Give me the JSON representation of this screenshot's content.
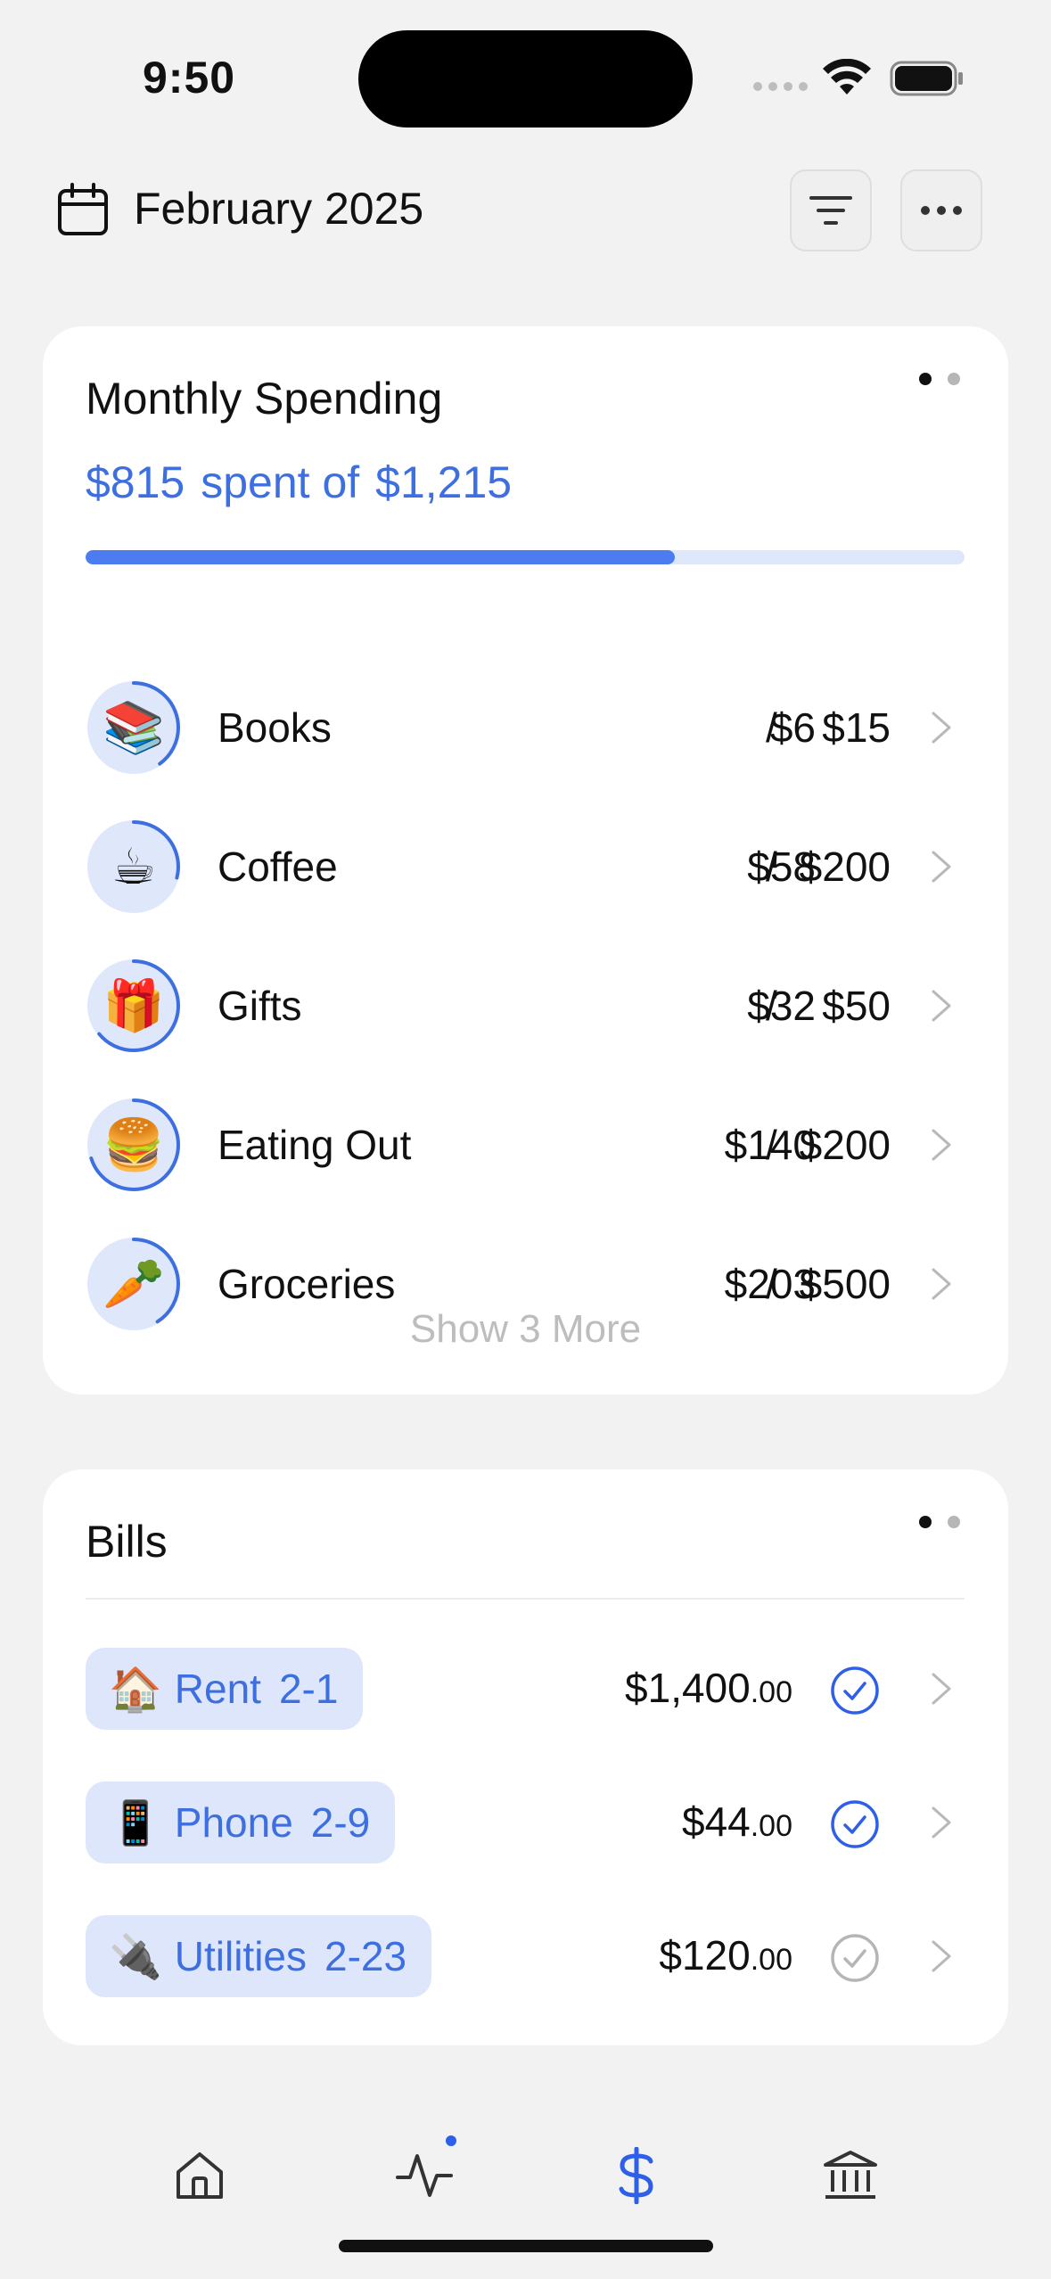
{
  "status_bar": {
    "time": "9:50"
  },
  "header": {
    "title": "February 2025"
  },
  "spending": {
    "title": "Monthly Spending",
    "spent": "$815",
    "spent_of": "spent of",
    "budget": "$1,215",
    "progress_fraction": 0.67,
    "accent_color": "#3d6fe0",
    "categories": [
      {
        "emoji": "📚",
        "name": "Books",
        "spent": "$6",
        "slash": "/",
        "budget": "$15",
        "fraction": 0.4
      },
      {
        "emoji": "☕",
        "name": "Coffee",
        "spent": "$58",
        "slash": "/",
        "budget": "$200",
        "fraction": 0.29
      },
      {
        "emoji": "🎁",
        "name": "Gifts",
        "spent": "$32",
        "slash": "/",
        "budget": "$50",
        "fraction": 0.64
      },
      {
        "emoji": "🍔",
        "name": "Eating Out",
        "spent": "$140",
        "slash": "/",
        "budget": "$200",
        "fraction": 0.7
      },
      {
        "emoji": "🥕",
        "name": "Groceries",
        "spent": "$203",
        "slash": "/",
        "budget": "$500",
        "fraction": 0.41
      }
    ],
    "show_more": "Show 3 More"
  },
  "bills": {
    "title": "Bills",
    "items": [
      {
        "emoji": "🏠",
        "name": "Rent",
        "date": "2-1",
        "amount": "$1,400",
        "cents": ".00",
        "paid": true
      },
      {
        "emoji": "📱",
        "name": "Phone",
        "date": "2-9",
        "amount": "$44",
        "cents": ".00",
        "paid": true
      },
      {
        "emoji": "🔌",
        "name": "Utilities",
        "date": "2-23",
        "amount": "$120",
        "cents": ".00",
        "paid": false
      }
    ]
  },
  "tabbar": {
    "active_tab": "money",
    "icons": [
      "home-icon",
      "activity-icon",
      "dollar-icon",
      "bank-icon"
    ]
  }
}
